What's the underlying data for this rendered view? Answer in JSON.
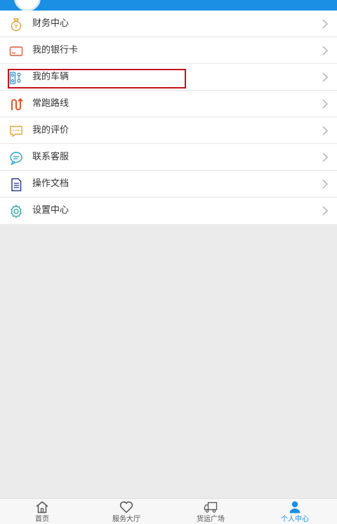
{
  "menu": {
    "items": [
      {
        "label": "财务中心",
        "icon": "money-bag-icon"
      },
      {
        "label": "我的银行卡",
        "icon": "bank-card-icon"
      },
      {
        "label": "我的车辆",
        "icon": "vehicle-icon"
      },
      {
        "label": "常跑路线",
        "icon": "route-icon"
      },
      {
        "label": "我的评价",
        "icon": "comment-icon"
      },
      {
        "label": "联系客服",
        "icon": "chat-icon"
      },
      {
        "label": "操作文档",
        "icon": "document-icon"
      },
      {
        "label": "设置中心",
        "icon": "gear-icon"
      }
    ]
  },
  "tabbar": {
    "tabs": [
      {
        "label": "首页",
        "icon": "home-icon",
        "active": false
      },
      {
        "label": "服务大厅",
        "icon": "heart-icon",
        "active": false
      },
      {
        "label": "货运广场",
        "icon": "truck-icon",
        "active": false
      },
      {
        "label": "个人中心",
        "icon": "user-icon",
        "active": true
      }
    ]
  },
  "colors": {
    "primary": "#1a8fe3",
    "highlight_border": "#c5121a",
    "background": "#ebebeb"
  }
}
